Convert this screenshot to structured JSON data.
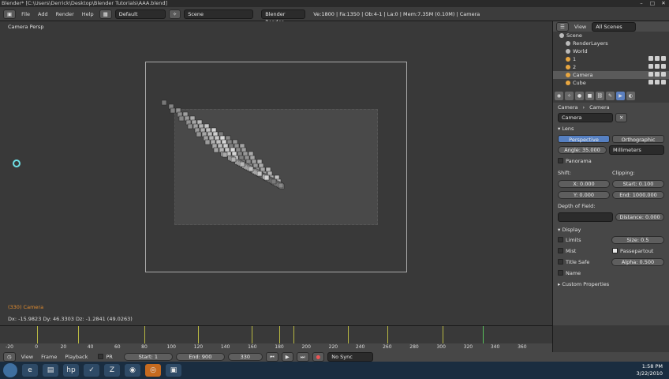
{
  "titlebar": {
    "text": "Blender* [C:\\Users\\Derrick\\Desktop\\Blender Tutorials\\AAA.blend]",
    "min": "–",
    "max": "□",
    "close": "✕"
  },
  "info": {
    "menus": [
      "File",
      "Add",
      "Render",
      "Help"
    ],
    "screen": "Default",
    "scene": "Scene",
    "engine": "Blender Render",
    "stats": "Ve:1800 | Fa:1350 | Ob:4-1 | La:0 | Mem:7.35M (0.10M) | Camera"
  },
  "viewport": {
    "label": "Camera Persp",
    "camera_name": "(330) Camera",
    "status": "Dx: -15.9823  Dy: 46.3303  Dz: -1.2841 (49.0263)"
  },
  "outliner": {
    "view": "View",
    "filter": "All Scenes",
    "items": [
      "Scene",
      "RenderLayers",
      "World",
      "1",
      "2",
      "Camera",
      "Cube"
    ]
  },
  "properties": {
    "breadcrumb": [
      "Camera",
      "Camera"
    ],
    "datablock": "Camera",
    "lens": {
      "title": "Lens",
      "perspective": "Perspective",
      "orthographic": "Orthographic",
      "angle": "Angle: 35.000",
      "unit": "Millimeters",
      "panorama": "Panorama"
    },
    "shift": {
      "title": "Shift:",
      "x": "X: 0.000",
      "y": "Y: 0.000"
    },
    "clipping": {
      "title": "Clipping:",
      "start": "Start: 0.100",
      "end": "End: 1000.000"
    },
    "dof": {
      "title": "Depth of Field:",
      "distance": "Distance: 0.000"
    },
    "display": {
      "title": "Display",
      "limits": "Limits",
      "mist": "Mist",
      "title_safe": "Title Safe",
      "name": "Name",
      "size": "Size: 0.5",
      "passepartout": "Passepartout",
      "alpha": "Alpha: 0.500"
    },
    "custom": "Custom Properties"
  },
  "timeline": {
    "ticks": [
      "-20",
      "0",
      "20",
      "40",
      "60",
      "80",
      "100",
      "120",
      "140",
      "160",
      "180",
      "200",
      "220",
      "240",
      "260",
      "280",
      "300",
      "320",
      "340",
      "360"
    ],
    "menus": [
      "View",
      "Frame",
      "Playback"
    ],
    "pr": "PR",
    "start": "Start: 1",
    "end": "End: 900",
    "current": "330",
    "sync": "No Sync"
  },
  "taskbar": {
    "time": "1:58 PM",
    "date": "3/22/2010"
  }
}
